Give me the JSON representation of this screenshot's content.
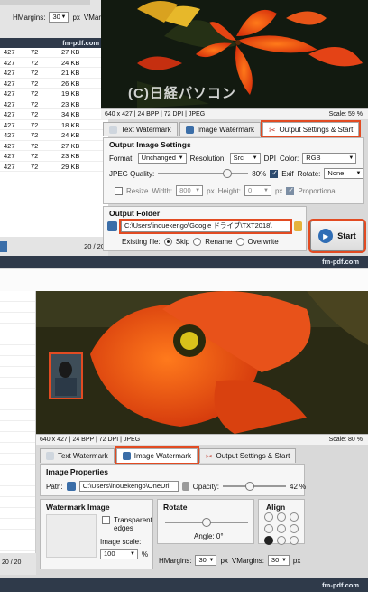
{
  "top": {
    "brand": "fm-pdf.com",
    "image_overlay": "(C)日経パソコン",
    "left_controls": {
      "hmargins_label": "HMargins:",
      "hmargins_value": "30",
      "px1": "px",
      "vmargins_label": "VMargins:",
      "vmargins_value": "30"
    },
    "file_list": [
      {
        "c1": "427",
        "c2": "72",
        "c3": "27 KB"
      },
      {
        "c1": "427",
        "c2": "72",
        "c3": "24 KB"
      },
      {
        "c1": "427",
        "c2": "72",
        "c3": "21 KB"
      },
      {
        "c1": "427",
        "c2": "72",
        "c3": "26 KB"
      },
      {
        "c1": "427",
        "c2": "72",
        "c3": "19 KB"
      },
      {
        "c1": "427",
        "c2": "72",
        "c3": "23 KB"
      },
      {
        "c1": "427",
        "c2": "72",
        "c3": "34 KB"
      },
      {
        "c1": "427",
        "c2": "72",
        "c3": "18 KB"
      },
      {
        "c1": "427",
        "c2": "72",
        "c3": "24 KB"
      },
      {
        "c1": "427",
        "c2": "72",
        "c3": "27 KB"
      },
      {
        "c1": "427",
        "c2": "72",
        "c3": "23 KB"
      },
      {
        "c1": "427",
        "c2": "72",
        "c3": "29 KB"
      }
    ],
    "list_count": "20 / 20",
    "status_info": "640 x 427 | 24 BPP | 72 DPI | JPEG",
    "scale": "Scale: 59 %",
    "tabs": [
      "Text Watermark",
      "Image Watermark",
      "Output Settings & Start"
    ],
    "output_image_settings": {
      "title": "Output Image Settings",
      "format_label": "Format:",
      "format_value": "Unchanged",
      "resolution_label": "Resolution:",
      "resolution_value": "Src",
      "dpi_label": "DPI",
      "color_label": "Color:",
      "color_value": "RGB",
      "jpeg_label": "JPEG Quality:",
      "jpeg_value": "80%",
      "jpeg_quality": 80,
      "exif_label": "Exif",
      "rotate_label": "Rotate:",
      "rotate_value": "None",
      "resize_label": "Resize",
      "width_label": "Width:",
      "width_value": "800",
      "px_a": "px",
      "height_label": "Height:",
      "height_value": "0",
      "px_b": "px",
      "proportional_label": "Proportional"
    },
    "output_folder": {
      "title": "Output Folder",
      "path": "C:\\Users\\inouekengo\\Google ドライブ\\TXT2018\\",
      "existing_label": "Existing file:",
      "options": [
        "Skip",
        "Rename",
        "Overwrite"
      ]
    },
    "start_label": "Start"
  },
  "bottom": {
    "brand": "fm-pdf.com",
    "list_count": "20 / 20",
    "status_info": "640 x 427 | 24 BPP | 72 DPI | JPEG",
    "scale": "Scale: 80 %",
    "tabs": [
      "Text Watermark",
      "Image Watermark",
      "Output Settings & Start"
    ],
    "image_properties": {
      "title": "Image Properties",
      "path_label": "Path:",
      "path_value": "C:\\Users\\inouekengo\\OneDri",
      "opacity_label": "Opacity:",
      "opacity_value": "42 %",
      "opacity": 42
    },
    "watermark_image": {
      "title": "Watermark Image",
      "transparent_label_1": "Transparent",
      "transparent_label_2": "edges",
      "scale_label": "Image scale:",
      "scale_value": "100",
      "percent": "%"
    },
    "rotate": {
      "title": "Rotate",
      "angle": "Angle: 0°"
    },
    "align": {
      "title": "Align"
    },
    "margins": {
      "hmargins_label": "HMargins:",
      "hmargins_value": "30",
      "px1": "px",
      "vmargins_label": "VMargins:",
      "vmargins_value": "30",
      "px2": "px"
    }
  }
}
